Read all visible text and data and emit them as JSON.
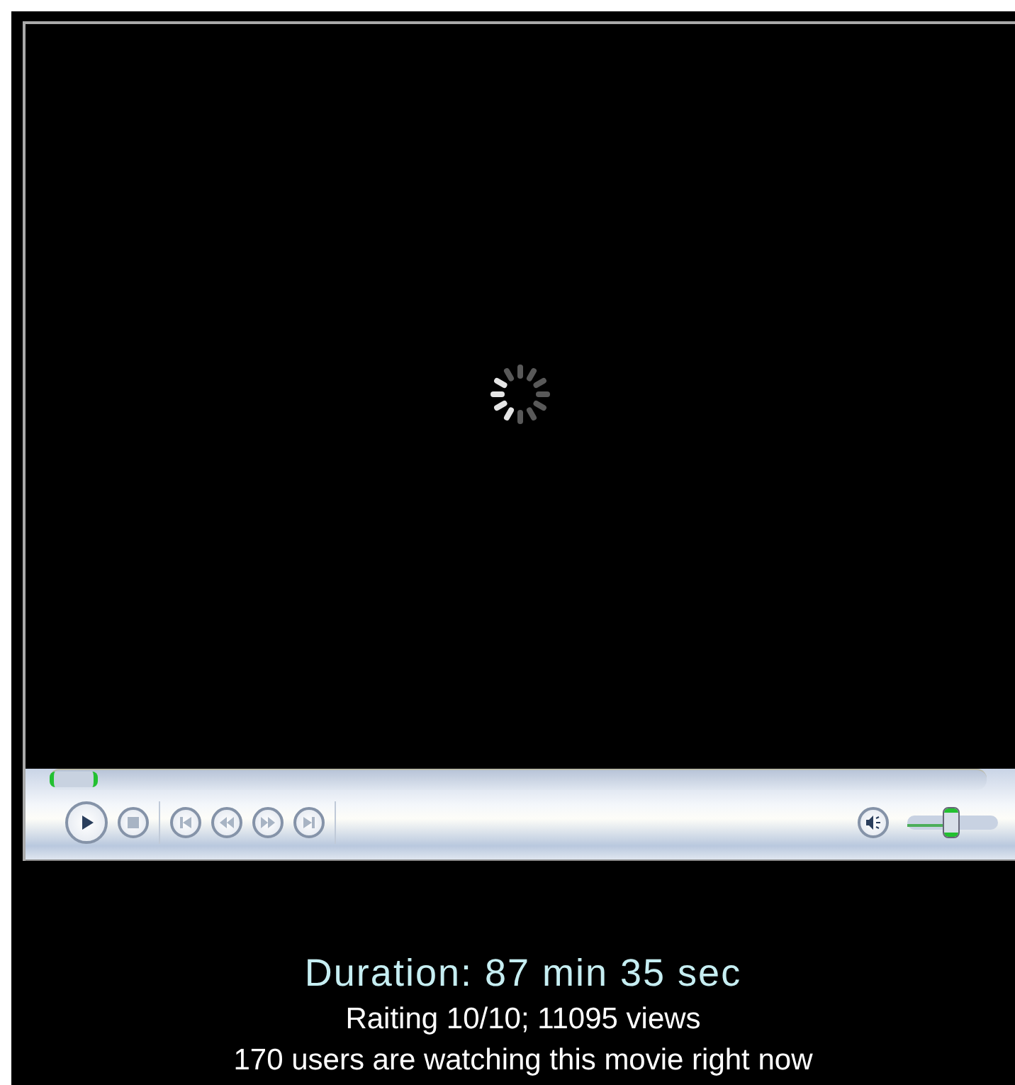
{
  "player": {
    "loading": true,
    "seek": {
      "level": 0.0
    },
    "volume": {
      "level": 0.5
    }
  },
  "info": {
    "duration": "Duration: 87 min 35 sec",
    "rating": "Raiting 10/10; 11095 views",
    "watching": "170 users are watching this movie right now"
  }
}
